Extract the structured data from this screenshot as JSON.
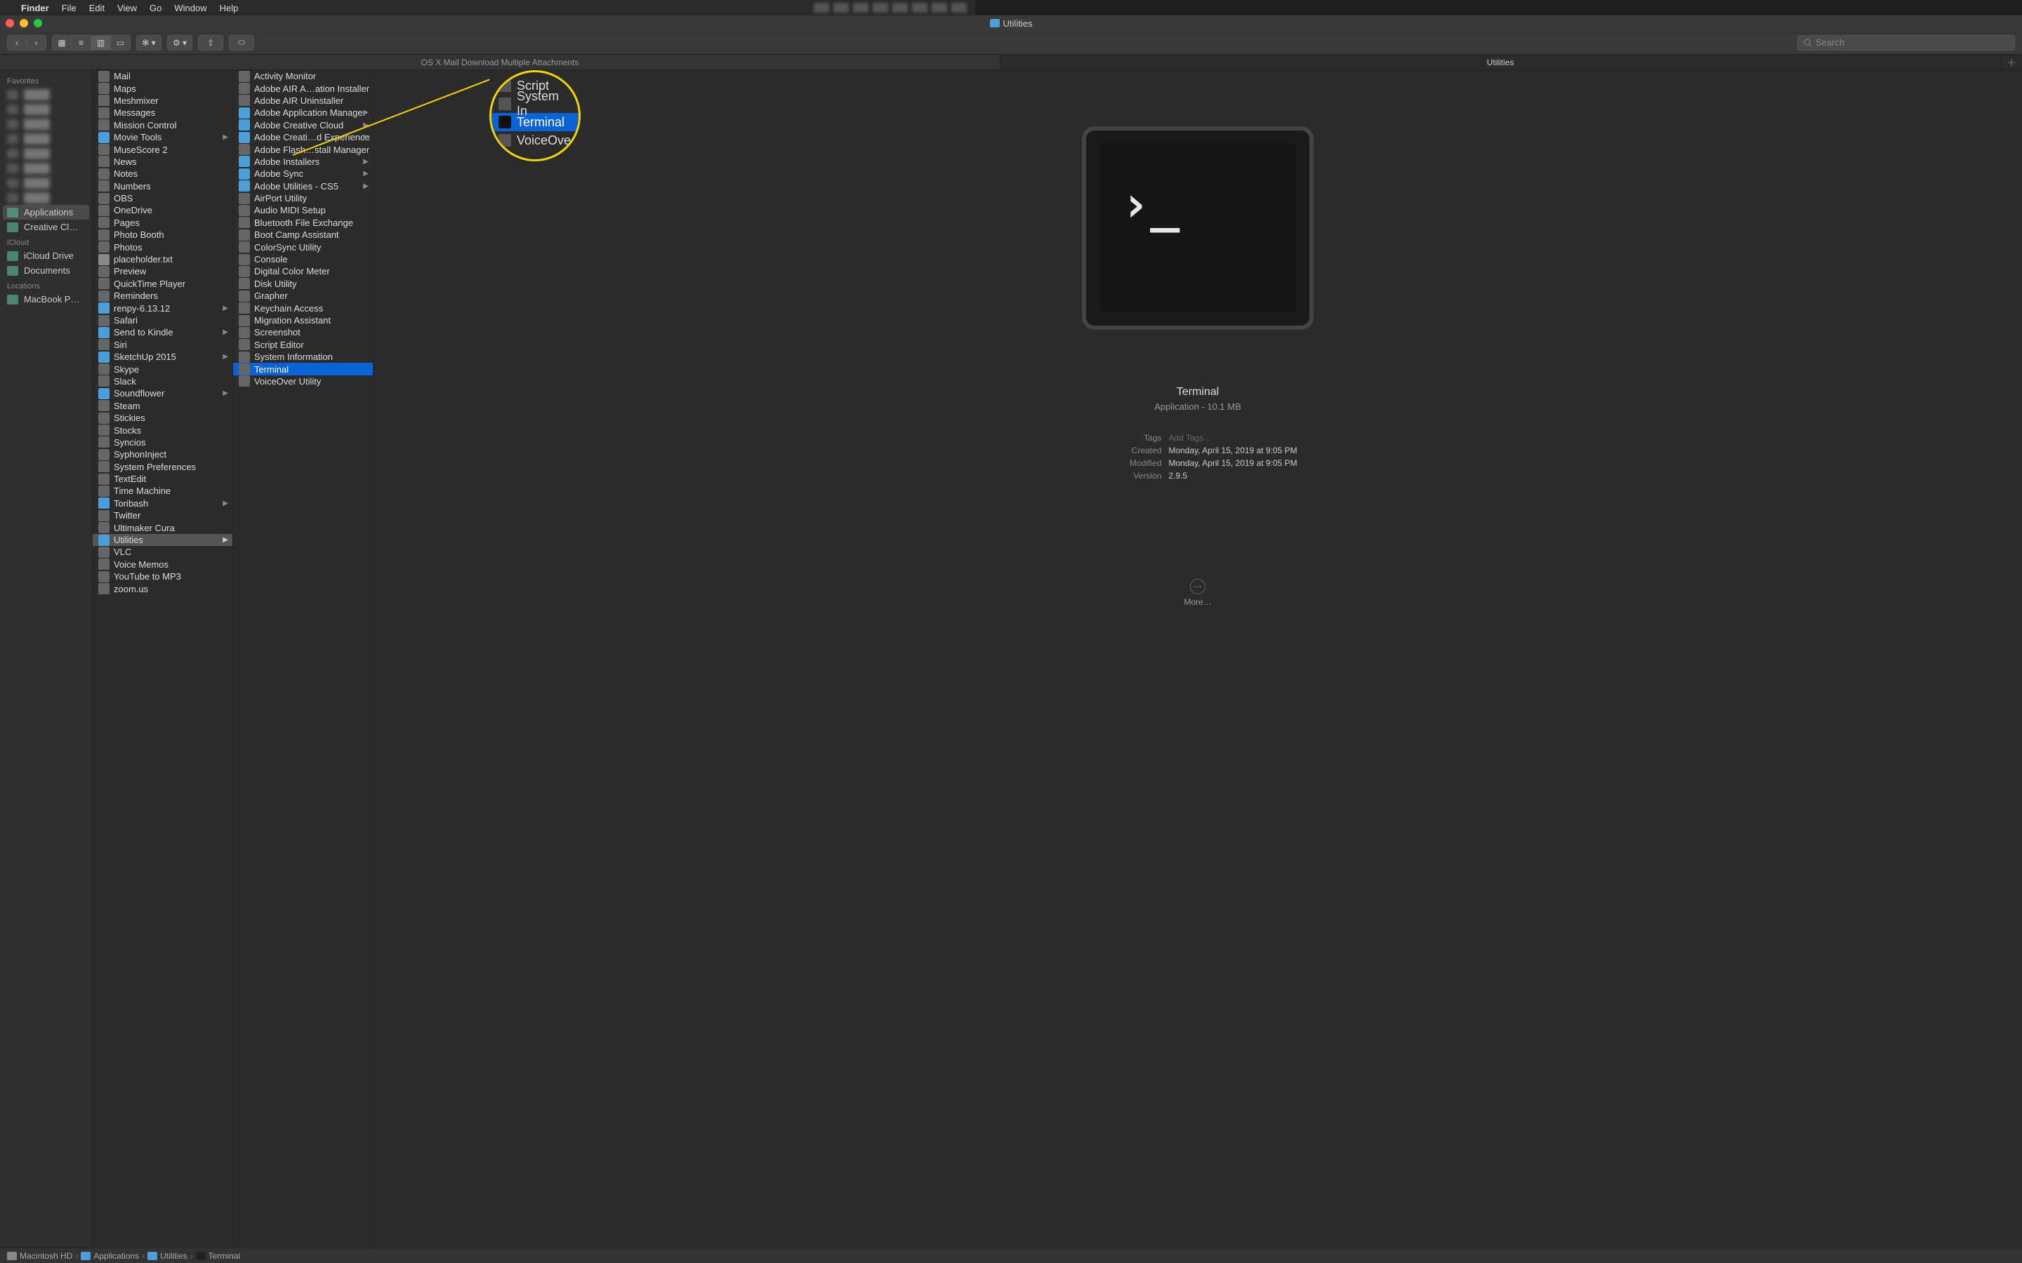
{
  "menubar": {
    "app": "Finder",
    "items": [
      "File",
      "Edit",
      "View",
      "Go",
      "Window",
      "Help"
    ]
  },
  "window": {
    "title": "Utilities"
  },
  "toolbar": {
    "search_placeholder": "Search"
  },
  "tabs": [
    "OS X Mail Download Multiple Attachments",
    "Utilities"
  ],
  "active_tab": 1,
  "sidebar": {
    "sections": [
      {
        "header": "Favorites",
        "items": [
          {
            "label": "",
            "blur": true
          },
          {
            "label": "",
            "blur": true
          },
          {
            "label": "",
            "blur": true
          },
          {
            "label": "",
            "blur": true
          },
          {
            "label": "",
            "blur": true
          },
          {
            "label": "",
            "blur": true
          },
          {
            "label": "",
            "blur": true
          },
          {
            "label": "",
            "blur": true
          },
          {
            "label": "Applications",
            "selected": true,
            "icon": "apps"
          },
          {
            "label": "Creative Cl…",
            "icon": "folder"
          }
        ]
      },
      {
        "header": "iCloud",
        "items": [
          {
            "label": "iCloud Drive",
            "icon": "cloud"
          },
          {
            "label": "Documents",
            "icon": "doc"
          }
        ]
      },
      {
        "header": "Locations",
        "items": [
          {
            "label": "MacBook P…",
            "icon": "laptop"
          }
        ]
      }
    ]
  },
  "col1": [
    {
      "label": "Mail",
      "icon": "app"
    },
    {
      "label": "Maps",
      "icon": "app"
    },
    {
      "label": "Meshmixer",
      "icon": "app"
    },
    {
      "label": "Messages",
      "icon": "app"
    },
    {
      "label": "Mission Control",
      "icon": "app"
    },
    {
      "label": "Movie Tools",
      "icon": "folder",
      "arrow": true
    },
    {
      "label": "MuseScore 2",
      "icon": "app"
    },
    {
      "label": "News",
      "icon": "app"
    },
    {
      "label": "Notes",
      "icon": "app"
    },
    {
      "label": "Numbers",
      "icon": "app"
    },
    {
      "label": "OBS",
      "icon": "app"
    },
    {
      "label": "OneDrive",
      "icon": "app"
    },
    {
      "label": "Pages",
      "icon": "app"
    },
    {
      "label": "Photo Booth",
      "icon": "app"
    },
    {
      "label": "Photos",
      "icon": "app"
    },
    {
      "label": "placeholder.txt",
      "icon": "file"
    },
    {
      "label": "Preview",
      "icon": "app"
    },
    {
      "label": "QuickTime Player",
      "icon": "app"
    },
    {
      "label": "Reminders",
      "icon": "app"
    },
    {
      "label": "renpy-6.13.12",
      "icon": "folder",
      "arrow": true
    },
    {
      "label": "Safari",
      "icon": "app"
    },
    {
      "label": "Send to Kindle",
      "icon": "folder",
      "arrow": true
    },
    {
      "label": "Siri",
      "icon": "app"
    },
    {
      "label": "SketchUp 2015",
      "icon": "folder",
      "arrow": true
    },
    {
      "label": "Skype",
      "icon": "app"
    },
    {
      "label": "Slack",
      "icon": "app"
    },
    {
      "label": "Soundflower",
      "icon": "folder",
      "arrow": true
    },
    {
      "label": "Steam",
      "icon": "app"
    },
    {
      "label": "Stickies",
      "icon": "app"
    },
    {
      "label": "Stocks",
      "icon": "app"
    },
    {
      "label": "Syncios",
      "icon": "app"
    },
    {
      "label": "SyphonInject",
      "icon": "app"
    },
    {
      "label": "System Preferences",
      "icon": "app"
    },
    {
      "label": "TextEdit",
      "icon": "app"
    },
    {
      "label": "Time Machine",
      "icon": "app"
    },
    {
      "label": "Toribash",
      "icon": "folder",
      "arrow": true
    },
    {
      "label": "Twitter",
      "icon": "app"
    },
    {
      "label": "Ultimaker Cura",
      "icon": "app"
    },
    {
      "label": "Utilities",
      "icon": "folder",
      "arrow": true,
      "selected": true
    },
    {
      "label": "VLC",
      "icon": "app"
    },
    {
      "label": "Voice Memos",
      "icon": "app"
    },
    {
      "label": "YouTube to MP3",
      "icon": "app"
    },
    {
      "label": "zoom.us",
      "icon": "app"
    }
  ],
  "col2": [
    {
      "label": "Activity Monitor",
      "icon": "app"
    },
    {
      "label": "Adobe AIR A…ation Installer",
      "icon": "app"
    },
    {
      "label": "Adobe AIR Uninstaller",
      "icon": "app"
    },
    {
      "label": "Adobe Application Manager",
      "icon": "folder",
      "arrow": true
    },
    {
      "label": "Adobe Creative Cloud",
      "icon": "folder",
      "arrow": true
    },
    {
      "label": "Adobe Creati…d Experience",
      "icon": "folder",
      "arrow": true
    },
    {
      "label": "Adobe Flash…stall Manager",
      "icon": "app"
    },
    {
      "label": "Adobe Installers",
      "icon": "folder",
      "arrow": true
    },
    {
      "label": "Adobe Sync",
      "icon": "folder",
      "arrow": true
    },
    {
      "label": "Adobe Utilities - CS5",
      "icon": "folder",
      "arrow": true
    },
    {
      "label": "AirPort Utility",
      "icon": "app"
    },
    {
      "label": "Audio MIDI Setup",
      "icon": "app"
    },
    {
      "label": "Bluetooth File Exchange",
      "icon": "app"
    },
    {
      "label": "Boot Camp Assistant",
      "icon": "app"
    },
    {
      "label": "ColorSync Utility",
      "icon": "app"
    },
    {
      "label": "Console",
      "icon": "app"
    },
    {
      "label": "Digital Color Meter",
      "icon": "app"
    },
    {
      "label": "Disk Utility",
      "icon": "app"
    },
    {
      "label": "Grapher",
      "icon": "app"
    },
    {
      "label": "Keychain Access",
      "icon": "app"
    },
    {
      "label": "Migration Assistant",
      "icon": "app"
    },
    {
      "label": "Screenshot",
      "icon": "app"
    },
    {
      "label": "Script Editor",
      "icon": "app"
    },
    {
      "label": "System Information",
      "icon": "app"
    },
    {
      "label": "Terminal",
      "icon": "app",
      "selected": true
    },
    {
      "label": "VoiceOver Utility",
      "icon": "app"
    }
  ],
  "preview": {
    "title": "Terminal",
    "subtitle": "Application - 10.1 MB",
    "meta": [
      {
        "k": "Tags",
        "v": "Add Tags…",
        "placeholder": true
      },
      {
        "k": "Created",
        "v": "Monday, April 15, 2019 at 9:05 PM"
      },
      {
        "k": "Modified",
        "v": "Monday, April 15, 2019 at 9:05 PM"
      },
      {
        "k": "Version",
        "v": "2.9.5"
      }
    ],
    "more": "More…"
  },
  "zoom_rows": [
    {
      "label": "Script "
    },
    {
      "label": "System In"
    },
    {
      "label": "Terminal",
      "blue": true
    },
    {
      "label": "VoiceOve"
    }
  ],
  "pathbar": [
    {
      "label": "Macintosh HD",
      "icon": "disk"
    },
    {
      "label": "Applications",
      "icon": "folder"
    },
    {
      "label": "Utilities",
      "icon": "folder"
    },
    {
      "label": "Terminal",
      "icon": "term"
    }
  ]
}
